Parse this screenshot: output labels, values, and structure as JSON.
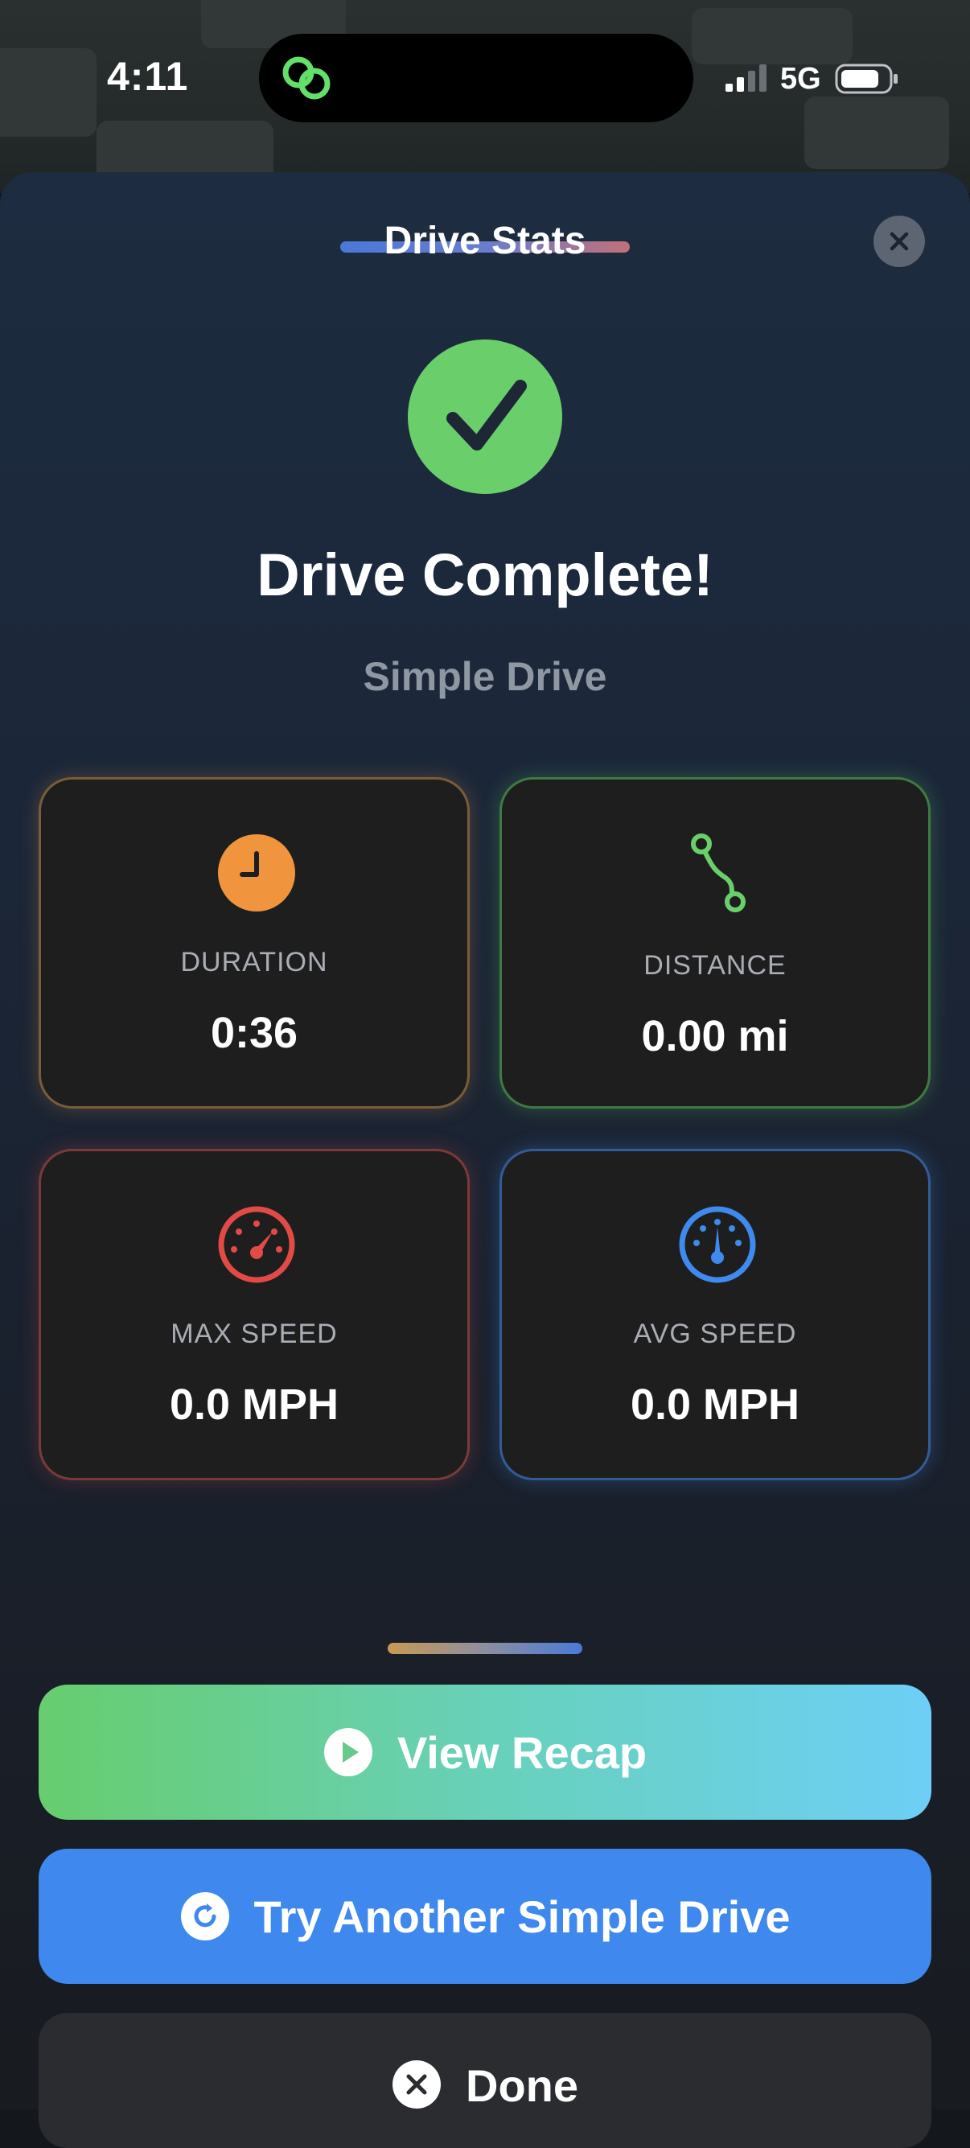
{
  "status_bar": {
    "time": "4:11",
    "network": "5G",
    "icons": [
      "app-link-icon",
      "signal-icon",
      "battery-icon"
    ]
  },
  "sheet": {
    "title": "Drive Stats",
    "close_icon": "close-icon"
  },
  "summary": {
    "headline": "Drive Complete!",
    "subtitle": "Simple Drive",
    "icon": "checkmark-icon"
  },
  "stats": [
    {
      "label": "DURATION",
      "value": "0:36",
      "icon": "clock-icon",
      "color": "#f0943e"
    },
    {
      "label": "DISTANCE",
      "value": "0.00 mi",
      "icon": "route-icon",
      "color": "#6acf6a"
    },
    {
      "label": "MAX SPEED",
      "value": "0.0 MPH",
      "icon": "speedometer-icon",
      "color": "#e24a46"
    },
    {
      "label": "AVG SPEED",
      "value": "0.0 MPH",
      "icon": "gauge-icon",
      "color": "#3e8aee"
    }
  ],
  "actions": {
    "view_recap": "View Recap",
    "try_again": "Try Another Simple Drive",
    "done": "Done"
  },
  "colors": {
    "success": "#6acf6a",
    "primary": "#3f88ee",
    "sheet_bg": "#1b2638"
  }
}
